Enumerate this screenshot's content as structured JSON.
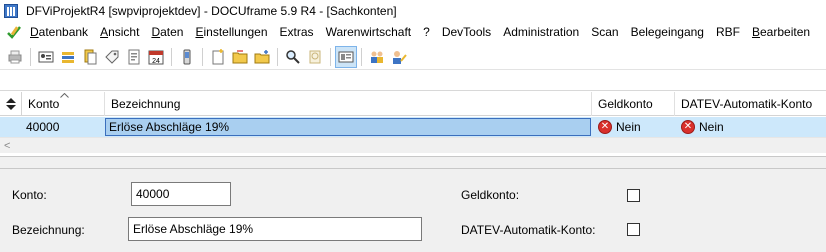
{
  "window": {
    "title": "DFViProjektR4 [swpviprojektdev] - DOCUframe 5.9 R4 - [Sachkonten]"
  },
  "menubar": {
    "items": [
      "Datenbank",
      "Ansicht",
      "Daten",
      "Einstellungen",
      "Extras",
      "Warenwirtschaft",
      "?",
      "DevTools",
      "Administration",
      "Scan",
      "Belegeingang",
      "RBF",
      "Bearbeiten"
    ]
  },
  "toolbar": {
    "icons": [
      "print-icon",
      "id-card-icon",
      "stack-icon",
      "document-icon",
      "tag-icon",
      "report-icon",
      "calendar-icon",
      "phone-icon",
      "new-document-icon",
      "folder-icon",
      "folder-add-icon",
      "search-icon",
      "find-replace-icon",
      "view-mode-icon",
      "users-icon",
      "user-edit-icon"
    ],
    "calendar_day": "24"
  },
  "grid": {
    "columns": [
      "Konto",
      "Bezeichnung",
      "Geldkonto",
      "DATEV-Automatik-Konto"
    ],
    "rows": [
      {
        "konto": "40000",
        "bezeichnung": "Erlöse Abschläge 19%",
        "geldkonto": "Nein",
        "datev": "Nein"
      }
    ]
  },
  "form": {
    "konto_label": "Konto:",
    "konto_value": "40000",
    "bezeichnung_label": "Bezeichnung:",
    "bezeichnung_value": "Erlöse Abschläge 19%",
    "geldkonto_label": "Geldkonto:",
    "geldkonto_checked": false,
    "datev_label": "DATEV-Automatik-Konto:",
    "datev_checked": false
  },
  "colors": {
    "selected_row": "#cde8fb",
    "edit_cell": "#a9cff0",
    "no_icon": "#d9302c"
  }
}
